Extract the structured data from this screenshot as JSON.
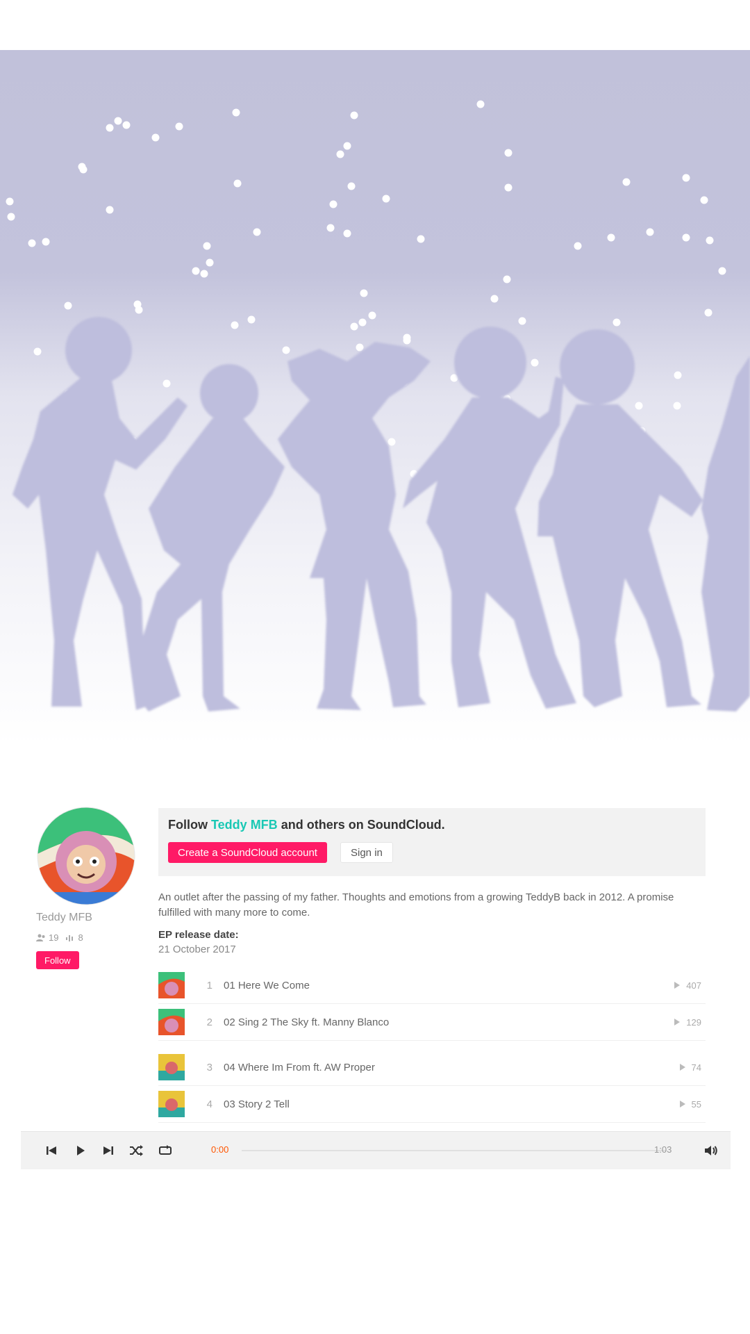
{
  "colors": {
    "accent": "#ff1a66",
    "artist_link": "#19c8b4",
    "hero_bg": "#c1c1da",
    "silhouette": "#bebedd",
    "player_accent": "#ff5500"
  },
  "banner": {
    "image": "dancing-silhouettes-illustration"
  },
  "artist": {
    "avatar": "cartoon-afro-character-avatar",
    "name": "Teddy MFB",
    "followers": "19",
    "tracks": "8",
    "follow_label": "Follow"
  },
  "signup": {
    "prefix": "Follow",
    "artist": "Teddy MFB",
    "suffix": "and others on SoundCloud.",
    "create_label": "Create a SoundCloud account",
    "signin_label": "Sign in"
  },
  "description": "An outlet after the passing of my father. Thoughts and emotions from a growing TeddyB back in 2012. A promise fulfilled with many more to come.",
  "release": {
    "label": "EP release date:",
    "date": "21 October 2017"
  },
  "tracks": [
    {
      "num": "1",
      "title": "01 Here We Come",
      "plays": "407",
      "art": "green-orange-cover"
    },
    {
      "num": "2",
      "title": "02 Sing 2 The Sky ft. Manny Blanco",
      "plays": "129",
      "art": "green-orange-cover"
    },
    {
      "num": "3",
      "title": "04 Where Im From ft. AW Proper",
      "plays": "74",
      "art": "yellow-teal-cover"
    },
    {
      "num": "4",
      "title": "03 Story 2 Tell",
      "plays": "55",
      "art": "yellow-teal-cover"
    }
  ],
  "player": {
    "current_time": "0:00",
    "total_time": "1:03",
    "progress": 0.0
  }
}
